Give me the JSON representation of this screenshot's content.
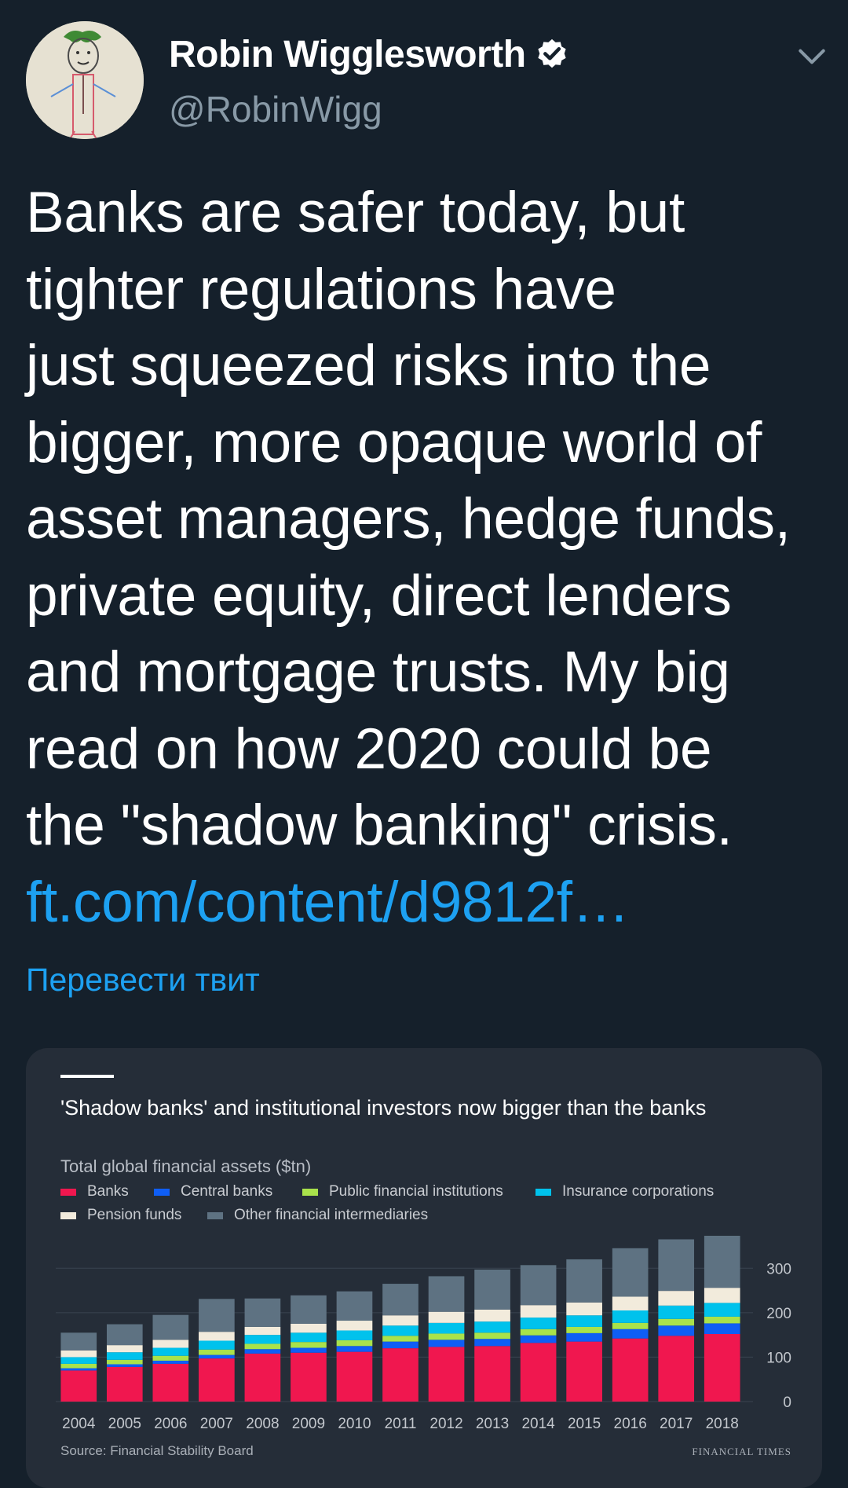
{
  "author": {
    "name": "Robin Wigglesworth",
    "handle": "@RobinWigg",
    "verified": true
  },
  "tweet": {
    "lines": [
      "Banks are safer today, but",
      "tighter regulations have",
      "just squeezed risks into the",
      "bigger, more opaque world of",
      "asset managers, hedge funds,",
      "private equity, direct lenders",
      "and mortgage trusts. My big",
      "read on how 2020 could be",
      "the \"shadow banking\" crisis."
    ],
    "link": "ft.com/content/d9812f…",
    "translate": "Перевести твит"
  },
  "icons": {
    "verified": "verified-badge-icon",
    "caret": "chevron-down-icon"
  },
  "colors": {
    "background": "#15202b",
    "card": "#252d38",
    "link": "#1da1f2",
    "muted": "#8899a6"
  },
  "chart_card": {
    "title": "'Shadow banks' and institutional investors now bigger than the banks",
    "subtitle": "Total global financial assets ($tn)",
    "source": "Source: Financial Stability Board",
    "brand": "FINANCIAL TIMES"
  },
  "chart_data": {
    "type": "bar",
    "stacked": true,
    "title": "'Shadow banks' and institutional investors now bigger than the banks",
    "subtitle": "Total global financial assets ($tn)",
    "categories": [
      "2004",
      "2005",
      "2006",
      "2007",
      "2008",
      "2009",
      "2010",
      "2011",
      "2012",
      "2013",
      "2014",
      "2015",
      "2016",
      "2017",
      "2018"
    ],
    "ylim": [
      0,
      380
    ],
    "yticks": [
      0,
      100,
      200,
      300
    ],
    "y_axis_position": "right",
    "grid": true,
    "legend_position": "top-left",
    "series": [
      {
        "name": "Banks",
        "color": "#f0174f",
        "values": [
          70,
          78,
          85,
          97,
          108,
          110,
          112,
          120,
          123,
          125,
          132,
          135,
          142,
          148,
          152
        ]
      },
      {
        "name": "Central banks",
        "color": "#0f5ef5",
        "values": [
          5,
          6,
          7,
          8,
          10,
          11,
          13,
          15,
          16,
          16,
          17,
          19,
          21,
          23,
          24
        ]
      },
      {
        "name": "Public financial institutions",
        "color": "#a9e24b",
        "values": [
          10,
          10,
          11,
          12,
          12,
          13,
          13,
          13,
          14,
          14,
          14,
          14,
          14,
          15,
          15
        ]
      },
      {
        "name": "Insurance corporations",
        "color": "#00c2ec",
        "values": [
          15,
          17,
          18,
          20,
          20,
          21,
          22,
          23,
          24,
          25,
          26,
          26,
          28,
          30,
          31
        ]
      },
      {
        "name": "Pension funds",
        "color": "#f2ebdc",
        "values": [
          15,
          16,
          18,
          20,
          18,
          20,
          22,
          23,
          25,
          27,
          28,
          29,
          31,
          33,
          34
        ]
      },
      {
        "name": "Other financial intermediaries",
        "color": "#5e7282",
        "values": [
          40,
          47,
          56,
          74,
          64,
          64,
          66,
          71,
          80,
          90,
          90,
          97,
          109,
          116,
          117
        ]
      }
    ]
  }
}
